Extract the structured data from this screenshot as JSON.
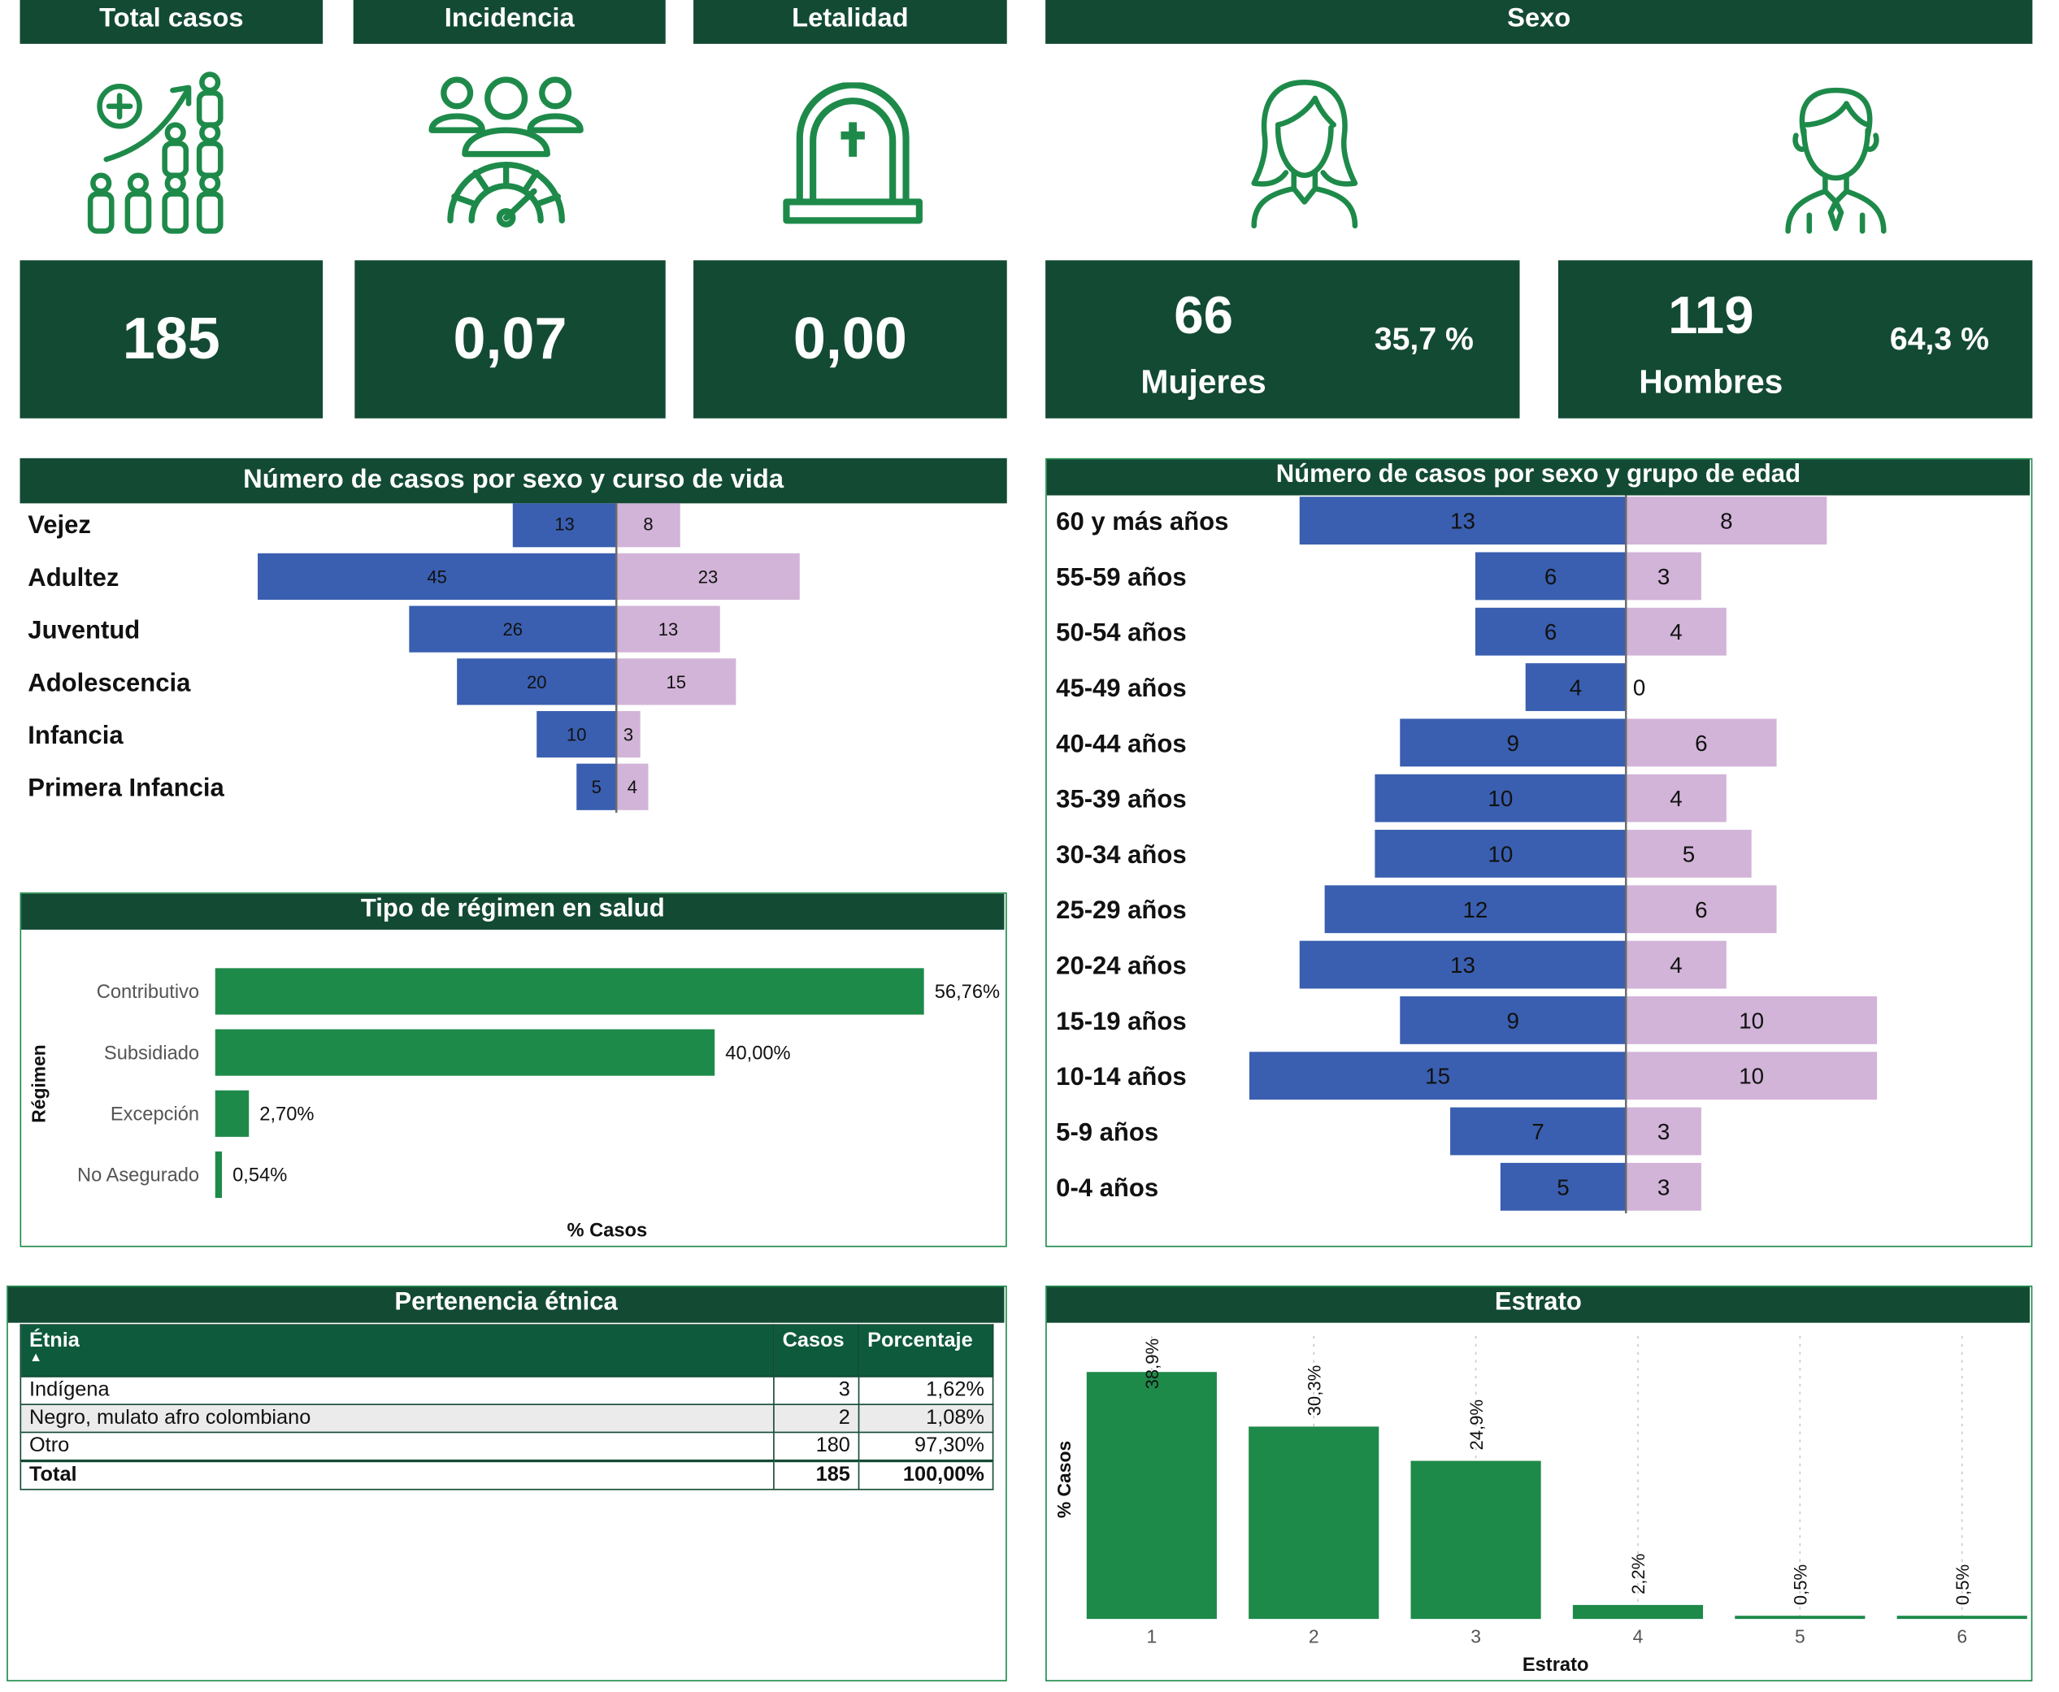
{
  "kpis": {
    "total": {
      "title": "Total casos",
      "value": "185"
    },
    "incidencia": {
      "title": "Incidencia",
      "value": "0,07"
    },
    "letalidad": {
      "title": "Letalidad",
      "value": "0,00"
    },
    "sexo": {
      "title": "Sexo"
    },
    "mujeres": {
      "count": "66",
      "label": "Mujeres",
      "pct": "35,7 %"
    },
    "hombres": {
      "count": "119",
      "label": "Hombres",
      "pct": "64,3 %"
    }
  },
  "icons": {
    "total": "community-growth-icon",
    "incidencia": "people-gauge-icon",
    "letalidad": "tombstone-icon",
    "mujeres": "woman-icon",
    "hombres": "man-icon"
  },
  "colors": {
    "dark_green": "#134a34",
    "accent_green": "#1e8a4a",
    "male_blue": "#3a5fb0",
    "female_lilac": "#d2b4d8"
  },
  "curso_vida": {
    "title": "Número de casos por sexo y curso de vida",
    "chart_data": {
      "type": "bar",
      "orientation": "horizontal-diverging",
      "categories": [
        "Vejez",
        "Adultez",
        "Juventud",
        "Adolescencia",
        "Infancia",
        "Primera Infancia"
      ],
      "series": [
        {
          "values": [
            13,
            45,
            26,
            20,
            10,
            5
          ],
          "color": "#3a5fb0"
        },
        {
          "values": [
            8,
            23,
            13,
            15,
            3,
            4
          ],
          "color": "#d2b4d8"
        }
      ]
    }
  },
  "grupo_edad": {
    "title": "Número de casos por sexo y grupo de edad",
    "chart_data": {
      "type": "bar",
      "orientation": "horizontal-diverging",
      "categories": [
        "60 y más años",
        "55-59 años",
        "50-54 años",
        "45-49 años",
        "40-44 años",
        "35-39 años",
        "30-34 años",
        "25-29 años",
        "20-24 años",
        "15-19 años",
        "10-14 años",
        "5-9 años",
        "0-4 años"
      ],
      "series": [
        {
          "values": [
            13,
            6,
            6,
            4,
            9,
            10,
            10,
            12,
            13,
            9,
            15,
            7,
            5
          ],
          "color": "#3a5fb0"
        },
        {
          "values": [
            8,
            3,
            4,
            0,
            6,
            4,
            5,
            6,
            4,
            10,
            10,
            3,
            3
          ],
          "color": "#d2b4d8"
        }
      ]
    }
  },
  "regimen": {
    "title": "Tipo de régimen en salud",
    "chart_data": {
      "type": "bar",
      "orientation": "horizontal",
      "categories": [
        "Contributivo",
        "Subsidiado",
        "Excepción",
        "No Asegurado"
      ],
      "values": [
        56.76,
        40.0,
        2.7,
        0.54
      ],
      "value_labels": [
        "56,76%",
        "40,00%",
        "2,70%",
        "0,54%"
      ],
      "xlabel": "% Casos",
      "ylabel": "Régimen",
      "xlim": [
        0,
        60
      ],
      "color": "#1e8a4a"
    }
  },
  "etnia": {
    "title": "Pertenencia étnica",
    "columns": [
      "Étnia",
      "Casos",
      "Porcentaje"
    ],
    "rows": [
      {
        "etnia": "Indígena",
        "casos": "3",
        "pct": "1,62%"
      },
      {
        "etnia": "Negro, mulato afro colombiano",
        "casos": "2",
        "pct": "1,08%"
      },
      {
        "etnia": "Otro",
        "casos": "180",
        "pct": "97,30%"
      }
    ],
    "total": {
      "label": "Total",
      "casos": "185",
      "pct": "100,00%"
    }
  },
  "estrato": {
    "title": "Estrato",
    "chart_data": {
      "type": "bar",
      "categories": [
        "1",
        "2",
        "3",
        "4",
        "5",
        "6"
      ],
      "values": [
        38.9,
        30.3,
        24.9,
        2.2,
        0.5,
        0.5
      ],
      "value_labels": [
        "38,9%",
        "30,3%",
        "24,9%",
        "2,2%",
        "0,5%",
        "0,5%"
      ],
      "xlabel": "Estrato",
      "ylabel": "% Casos",
      "ylim": [
        0,
        40
      ],
      "color": "#1e8a4a"
    }
  }
}
